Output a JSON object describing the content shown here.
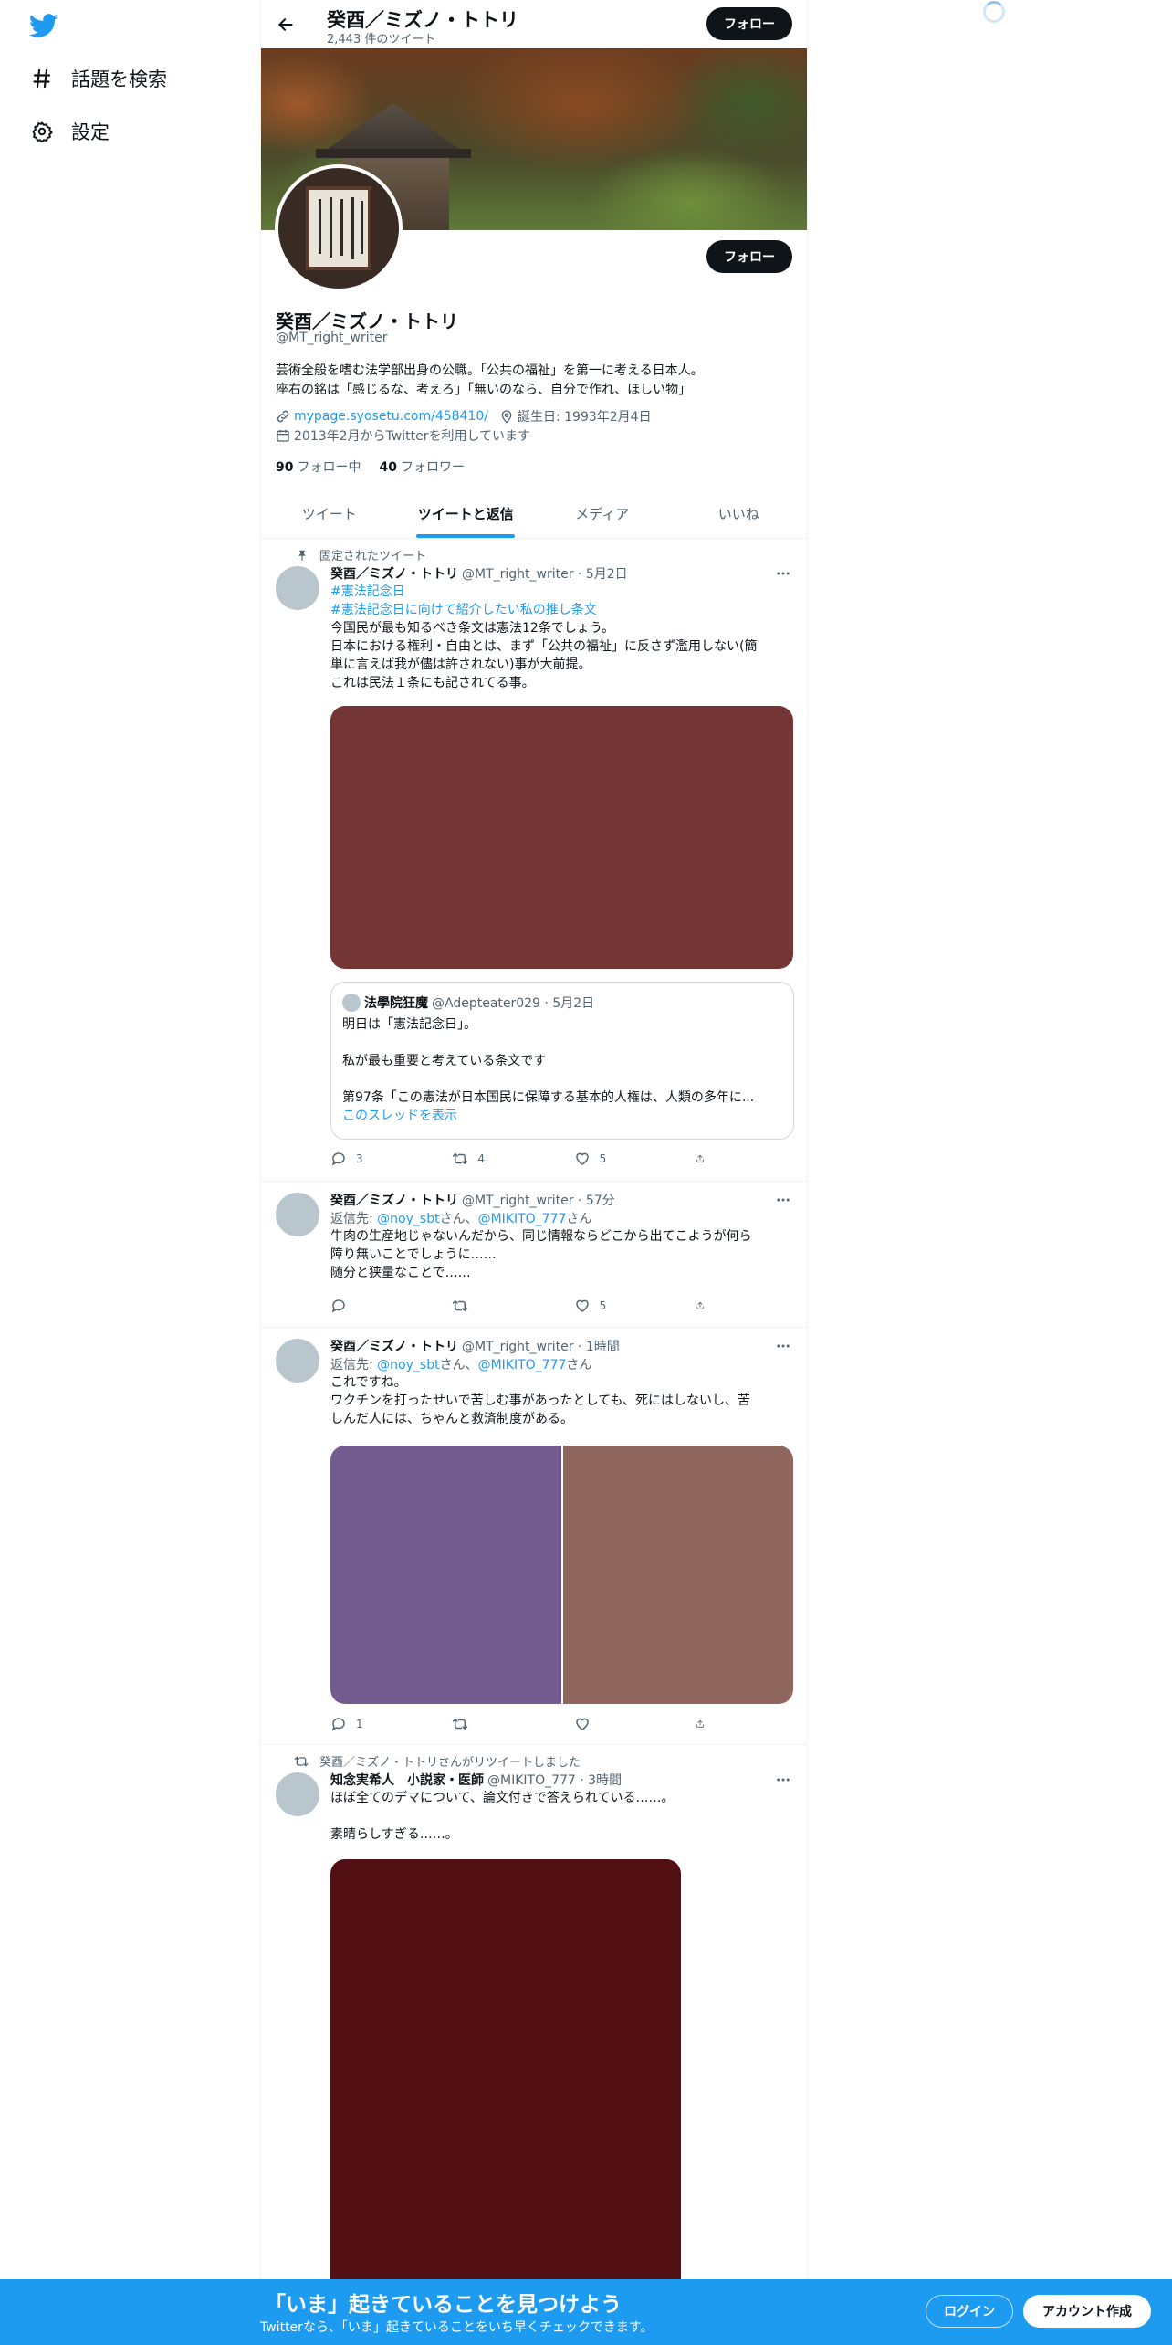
{
  "colors": {
    "accent": "#1d9bf0",
    "text": "#0f1419",
    "muted": "#536471",
    "dark_button": "#0f1419"
  },
  "nav": {
    "logo_icon": "twitter-bird-icon",
    "items": [
      {
        "icon": "hash-icon",
        "label": "話題を検索"
      },
      {
        "icon": "gear-icon",
        "label": "設定"
      }
    ]
  },
  "header": {
    "name": "癸酉／ミズノ・トトリ",
    "tweet_count": "2,443 件のツイート",
    "follow_label": "フォロー"
  },
  "profile": {
    "name": "癸酉／ミズノ・トトリ",
    "handle": "@MT_right_writer",
    "bio": [
      "芸術全般を嗜む法学部出身の公職。「公共の福祉」を第一に考える日本人。",
      "座右の銘は「感じるな、考えろ」「無いのなら、自分で作れ、ほしい物」"
    ],
    "url": "mypage.syosetu.com/458410/",
    "birthday": "誕生日: 1993年2月4日",
    "joined": "2013年2月からTwitterを利用しています",
    "following_count": "90",
    "following_label": "フォロー中",
    "followers_count": "40",
    "followers_label": "フォロワー",
    "follow_label": "フォロー"
  },
  "tabs": [
    {
      "label": "ツイート"
    },
    {
      "label": "ツイートと返信",
      "active": true
    },
    {
      "label": "メディア"
    },
    {
      "label": "いいね"
    }
  ],
  "tweets": [
    {
      "context": "固定されたツイート",
      "name": "癸酉／ミズノ・トトリ",
      "handle_time": "@MT_right_writer · 5月2日",
      "hashtags": [
        "#憲法記念日",
        "#憲法記念日に向けて紹介したい私の推し条文"
      ],
      "text": [
        "今国民が最も知るべき条文は憲法12条でしょう。",
        "日本における権利・自由とは、まず「公共の福祉」に反さず濫用しない(簡",
        "単に言えば我が儘は許されない)事が大前提。",
        "これは民法１条にも記されてる事。"
      ],
      "media_color": "#733535",
      "quote": {
        "name": "法學院狂魔",
        "handle_time": "@Adepteater029 · 5月2日",
        "lines": [
          "明日は「憲法記念日」。",
          "",
          "私が最も重要と考えている条文です",
          "",
          "第97条「この憲法が日本国民に保障する基本的人権は、人類の多年に..."
        ],
        "thread_link": "このスレッドを表示"
      },
      "replies": "3",
      "retweets": "4",
      "likes": "5"
    },
    {
      "name": "癸酉／ミズノ・トトリ",
      "handle_time": "@MT_right_writer · 57分",
      "reply_to_prefix": "返信先: ",
      "reply_to_1": "@noy_sbt",
      "reply_to_mid": "さん、",
      "reply_to_2": "@MIKITO_777",
      "reply_to_suffix": "さん",
      "text": [
        "牛肉の生産地じゃないんだから、同じ情報ならどこから出てこようが何ら",
        "障り無いことでしょうに……",
        "随分と狭量なことで……"
      ],
      "replies": "",
      "retweets": "",
      "likes": "5"
    },
    {
      "name": "癸酉／ミズノ・トトリ",
      "handle_time": "@MT_right_writer · 1時間",
      "reply_to_prefix": "返信先: ",
      "reply_to_1": "@noy_sbt",
      "reply_to_mid": "さん、",
      "reply_to_2": "@MIKITO_777",
      "reply_to_suffix": "さん",
      "text": [
        "これですね。",
        "ワクチンを打ったせいで苦しむ事があったとしても、死にはしないし、苦",
        "しんだ人には、ちゃんと救済制度がある。"
      ],
      "media_colors": [
        "#735a8f",
        "#8f665e"
      ],
      "replies": "1",
      "retweets": "",
      "likes": ""
    },
    {
      "context": "癸酉／ミズノ・トトリさんがリツイートしました",
      "name": "知念実希人　小説家・医師",
      "handle_time": "@MIKITO_777 · 3時間",
      "text": [
        "ほぼ全てのデマについて、論文付きで答えられている……。",
        "",
        "素晴らしすぎる……。"
      ],
      "media_color": "#520f14"
    }
  ],
  "bottom_bar": {
    "title": "「いま」起きていることを見つけよう",
    "subtitle": "Twitterなら、「いま」起きていることをいち早くチェックできます。",
    "login_label": "ログイン",
    "signup_label": "アカウント作成"
  }
}
